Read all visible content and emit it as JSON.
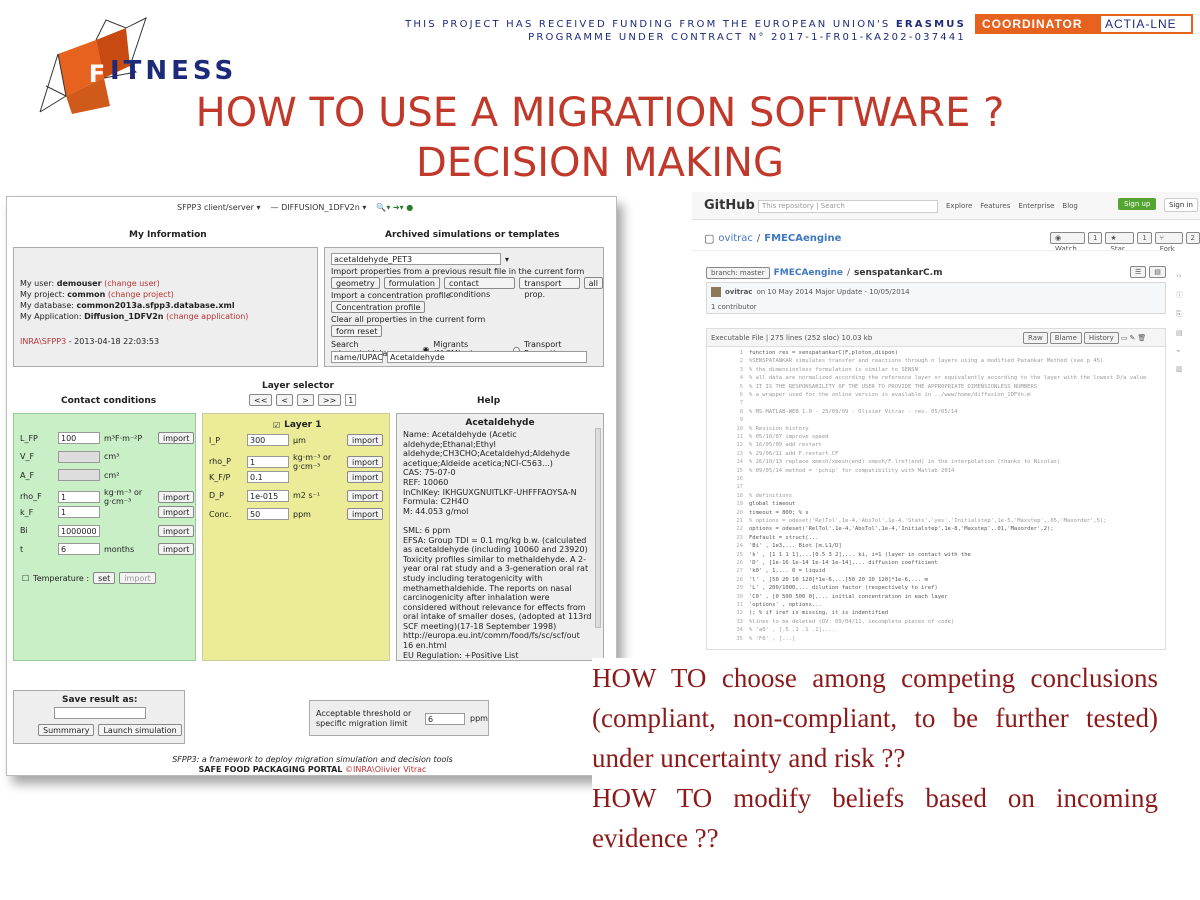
{
  "header": {
    "funding_line1_pre": "THIS PROJECT HAS RECEIVED FUNDING FROM THE EUROPEAN UNION'S",
    "funding_line1_bold": "ERASMUS",
    "funding_line2": "PROGRAMME UNDER CONTRACT N° 2017-1-FR01-KA202-037441",
    "coordinator_label": "COORDINATOR",
    "coordinator_name": "ACTIA-LNE",
    "logo_letter": "F",
    "logo_rest": "ITNESS",
    "title_line1": "HOW TO USE A MIGRATION SOFTWARE ?",
    "title_line2": "DECISION MAKING",
    "accent": "#c0392b",
    "brand": "#1d2a7a",
    "orange": "#e8621f"
  },
  "sfpp": {
    "topbar": {
      "client": "SFPP3 client/server",
      "model": "DIFFUSION_1DFV2n"
    },
    "my_info": {
      "heading": "My Information",
      "user_label": "My user:",
      "user": "demouser",
      "user_link": "(change user)",
      "project_label": "My project:",
      "project": "common",
      "project_link": "(change project)",
      "db_label": "My database:",
      "db": "common2013a.sfpp3.database.xml",
      "app_label": "My Application:",
      "app": "Diffusion_1DFV2n",
      "app_link": "(change application)",
      "stamp_link": "INRA\\SFPP3",
      "stamp": "- 2013-04-18 22:03:53"
    },
    "archived": {
      "heading": "Archived simulations or templates",
      "select": "acetaldehyde_PET3",
      "import_text": "Import properties from a previous result file in the current form",
      "btn_geometry": "geometry",
      "btn_formulation": "formulation",
      "btn_contact": "contact conditions",
      "btn_transport": "transport prop.",
      "btn_all": "all",
      "import_conc": "Import a concentration profile",
      "btn_conc": "Concentration profile",
      "clear_text": "Clear all properties in the current form",
      "btn_reset": "form reset",
      "search_label": "Search migrants/data:",
      "radio1": "Migrants (M,SML...)",
      "radio2": "Transport Properties",
      "search_type": "name/IUPAC",
      "search_value": "Acetaldehyde"
    },
    "contact": {
      "heading": "Contact conditions",
      "rows": [
        {
          "label": "L_FP",
          "value": "100",
          "unit": "m³F·m⁻²P",
          "btn": "import"
        },
        {
          "label": "V_F",
          "value": "",
          "unit": "cm³",
          "btn": ""
        },
        {
          "label": "A_F",
          "value": "",
          "unit": "cm²",
          "btn": ""
        },
        {
          "label": "rho_F",
          "value": "1",
          "unit": "kg·m⁻³ or g·cm⁻³",
          "btn": "import"
        },
        {
          "label": "k_F",
          "value": "1",
          "unit": "",
          "btn": "import"
        },
        {
          "label": "Bi",
          "value": "1000000",
          "unit": "",
          "btn": "import"
        },
        {
          "label": "t",
          "value": "6",
          "unit": "months",
          "btn": "import"
        }
      ],
      "temperature": "Temperature :",
      "set": "set",
      "import": "import"
    },
    "layer": {
      "selector": "Layer selector",
      "nav": [
        "<<",
        "<",
        ">",
        ">>"
      ],
      "index": "1",
      "heading": "Layer 1",
      "rows": [
        {
          "label": "l_P",
          "value": "300",
          "unit": "µm",
          "btn": "import"
        },
        {
          "label": "rho_P",
          "value": "1",
          "unit": "kg·m⁻³ or g·cm⁻³",
          "btn": "import"
        },
        {
          "label": "K_F/P",
          "value": "0.1",
          "unit": "",
          "btn": "import"
        },
        {
          "label": "D_P",
          "value": "1e-015",
          "unit": "m2 s⁻¹",
          "btn": "import"
        },
        {
          "label": "Conc.",
          "value": "50",
          "unit": "ppm",
          "btn": "import"
        }
      ]
    },
    "help": {
      "heading": "Help",
      "name": "Acetaldehyde",
      "lines": [
        "Name: Acetaldehyde (Acetic aldehyde;Ethanal;Ethyl",
        "aldehyde;CH3CHO;Acetaldehyd;Aldehyde",
        "acetique;Aldeide acetica;NCI-C563...)",
        "CAS: 75-07-0",
        "REF: 10060",
        "InChIKey: IKHGUXGNUITLKF-UHFFFAOYSA-N",
        "Formula: C2H4O",
        "M: 44.053 g/mol",
        "",
        "SML: 6 ppm",
        "EFSA: Group TDI = 0.1 mg/kg b.w. (calculated",
        "as acetaldehyde (including 10060 and 23920)",
        "Toxicity profiles similar to methaldehyde. A 2-",
        "year oral rat study and a 3-generation oral rat",
        "study including teratogenicity with",
        "methamethaldehide. The reports on nasal",
        "carcinogenicity after inhalation were",
        "considered without relevance for effects from",
        "oral intake of smaller doses, (adopted at 113rd",
        "SCF meeting)(17-18 September 1998)",
        "http://europa.eu.int/comm/food/fs/sc/scf/out",
        "16 en.html",
        "EU Regulation: +Positive List"
      ]
    },
    "save": {
      "heading": "Save result as:",
      "btn_summary": "Summmary",
      "btn_launch": "Launch simulation"
    },
    "threshold": {
      "label": "Acceptable threshold or specific migration limit",
      "value": "6",
      "unit": "ppm"
    },
    "footer": {
      "line1": "SFPP3: a framework to deploy migration simulation and decision tools",
      "line2": "SAFE FOOD PACKAGING PORTAL",
      "copy": "©INRA\\Olivier Vitrac"
    }
  },
  "github": {
    "logo": "GitHub",
    "repo_label": "This repository",
    "search": "Search",
    "nav": [
      "Explore",
      "Features",
      "Enterprise",
      "Blog"
    ],
    "signup": "Sign up",
    "signin": "Sign in",
    "owner": "ovitrac",
    "repo": "FMECAengine",
    "watch": "Watch",
    "watch_n": "1",
    "star": "Star",
    "star_n": "1",
    "fork": "Fork",
    "fork_n": "2",
    "branch": "branch: master",
    "path_repo": "FMECAengine",
    "path_file": "senspatankarC.m",
    "commit_user": "ovitrac",
    "commit_msg": "on 10 May 2014 Major Update - 10/05/2014",
    "contributor": "1 contributor",
    "file_info": "Executable File | 275 lines (252 sloc) 10.03 kb",
    "raw": "Raw",
    "blame": "Blame",
    "history": "History",
    "code_lines": [
      "function res = senspatankarC(F,ploton,dispon)",
      "%SENSPATANKAR simulates transfer and reactions through n layers using a modified Patankar Method (see p 45)",
      "%   the dimensionless formulation is similar to SENSN",
      "%   all data are normalized according the reference layer or equivalently according to the layer with the lowest D/a value",
      "%   IT IS THE RESPONSABILITY OF THE USER TO PROVIDE THE APPROPRIATE DIMENSIONLESS NUMBERS",
      "%   a wrapper used for the online version is available in ../www/home/diffusion_1DFVn.m",
      "",
      "% MS-MATLAB-WEB 1.0 - 25/09/09 - Olivier Vitrac - rev. 05/05/14",
      "",
      "% Revision history",
      "% 05/10/07 improve speed",
      "% 16/05/09 add restart",
      "% 29/06/11 add F.restart.CF",
      "% 26/10/13 replace xmesh/xmesh(end) xmesh/F.lref(end) in the interpolation (thanks to Nicolas)",
      "% 09/05/14 method = 'pchip'  for compatibility with Matlab 2014",
      "",
      "",
      "% definitions",
      "global timeout",
      "timeout       = 800; % s",
      "% options      = odeset('RelTol',1e-4,'AbsTol',1e-4,'Stats','yes','Initialstep',1e-5,'Maxstep',.05,'Maxorder',5);",
      "options       = odeset('RelTol',1e-4,'AbsTol',1e-4,'Initialstep',1e-8,'Maxstep',.01,'Maxorder',2);",
      "Fdefault      = struct(...",
      "                 'Bi'        ,    1e3,...  Biot [m.L1/D]",
      "                 'k'         ,    [1 1 1 1],...[0.5 3 2],...     ki, i=1 (layer in contact with the",
      "        'D'      ,  [1e-16 1e-14 1e-14 1e-14],... diffusion coefficient",
      "        'k0'     ,  1,... 0 = liquid",
      "        'l'      ,  [50 20 10 120]*1e-6,...[50 20 10 120]*1e-6,... m",
      "                 'L'         ,    200/1000,...   dilution factor (respectively to iref)",
      "                 'C0'        ,    [0 500 500 0],...      initial concentration in each layer",
      "                 'options'   ,    options...",
      "                             ); % if iref is missing, it is indentified",
      "%lines to be deleted (OV: 09/04/11, incomplete pieces of code)",
      "%                'a0'        ,    [.5 .1 .1 .1],...",
      "%                'F0'        ,    [...]"
    ]
  },
  "body": {
    "para1": "HOW TO choose among competing conclusions (compliant, non-compliant, to be further tested) under uncertainty and risk ??",
    "para2": "HOW TO modify beliefs based on incoming evidence ??",
    "color": "#8b1a1a"
  }
}
